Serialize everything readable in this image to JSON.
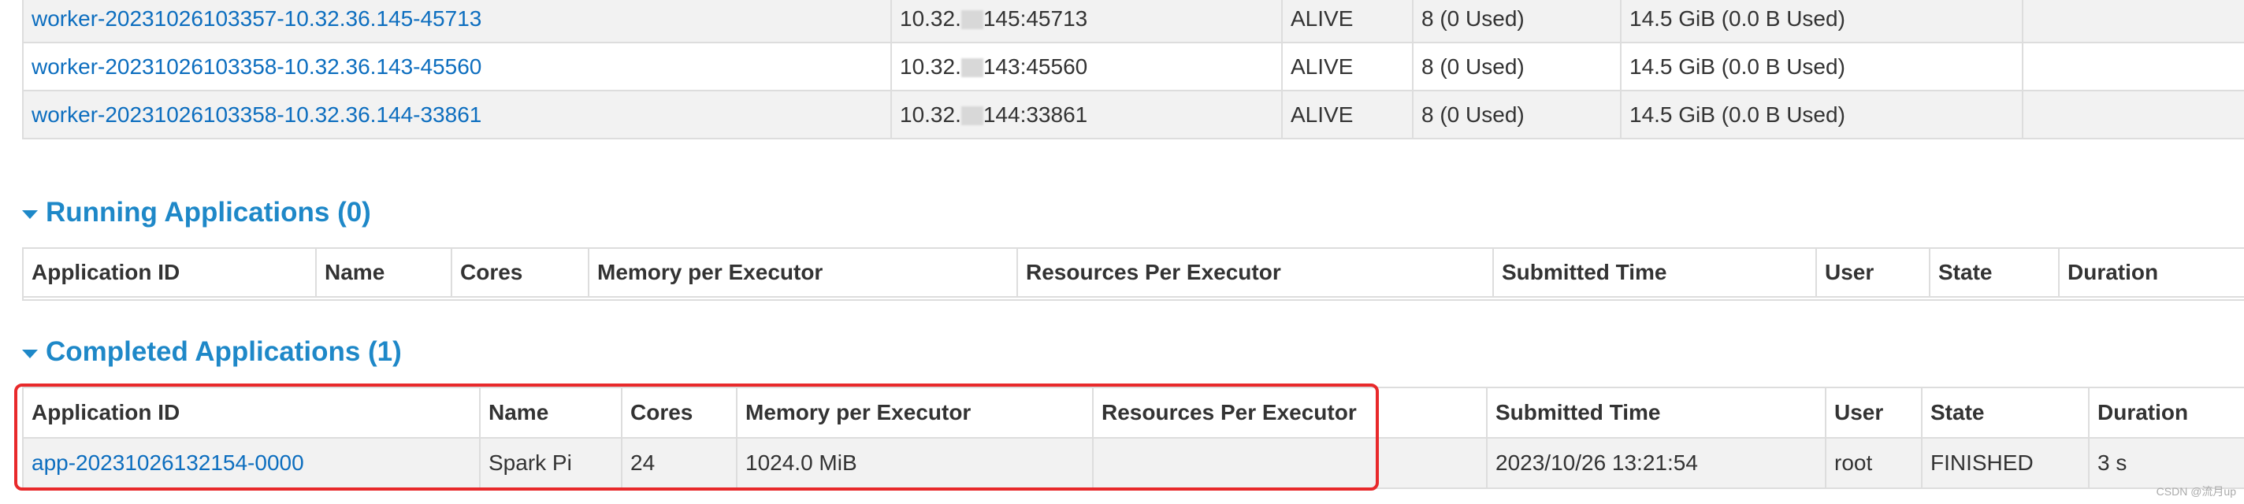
{
  "workers": {
    "rows": [
      {
        "id": "worker-20231026103357-10.32.36.145-45713",
        "address_prefix": "10.32.",
        "address_suffix": "145:45713",
        "state": "ALIVE",
        "cores": "8 (0 Used)",
        "memory": "14.5 GiB (0.0 B Used)",
        "resources": ""
      },
      {
        "id": "worker-20231026103358-10.32.36.143-45560",
        "address_prefix": "10.32.",
        "address_suffix": "143:45560",
        "state": "ALIVE",
        "cores": "8 (0 Used)",
        "memory": "14.5 GiB (0.0 B Used)",
        "resources": ""
      },
      {
        "id": "worker-20231026103358-10.32.36.144-33861",
        "address_prefix": "10.32.",
        "address_suffix": "144:33861",
        "state": "ALIVE",
        "cores": "8 (0 Used)",
        "memory": "14.5 GiB (0.0 B Used)",
        "resources": ""
      }
    ]
  },
  "running": {
    "title": "Running Applications (0)",
    "headers": [
      "Application ID",
      "Name",
      "Cores",
      "Memory per Executor",
      "Resources Per Executor",
      "Submitted Time",
      "User",
      "State",
      "Duration"
    ]
  },
  "completed": {
    "title": "Completed Applications (1)",
    "headers": [
      "Application ID",
      "Name",
      "Cores",
      "Memory per Executor",
      "Resources Per Executor",
      "Submitted Time",
      "User",
      "State",
      "Duration"
    ],
    "rows": [
      {
        "app_id": "app-20231026132154-0000",
        "name": "Spark Pi",
        "cores": "24",
        "memory": "1024.0 MiB",
        "resources": "",
        "submitted": "2023/10/26 13:21:54",
        "user": "root",
        "state": "FINISHED",
        "duration": "3 s"
      }
    ]
  },
  "watermark": "CSDN @流月up",
  "colors": {
    "link": "#0d6ebf",
    "section_header": "#1e88c8",
    "highlight": "#e8292b",
    "stripe": "#f2f2f2"
  }
}
